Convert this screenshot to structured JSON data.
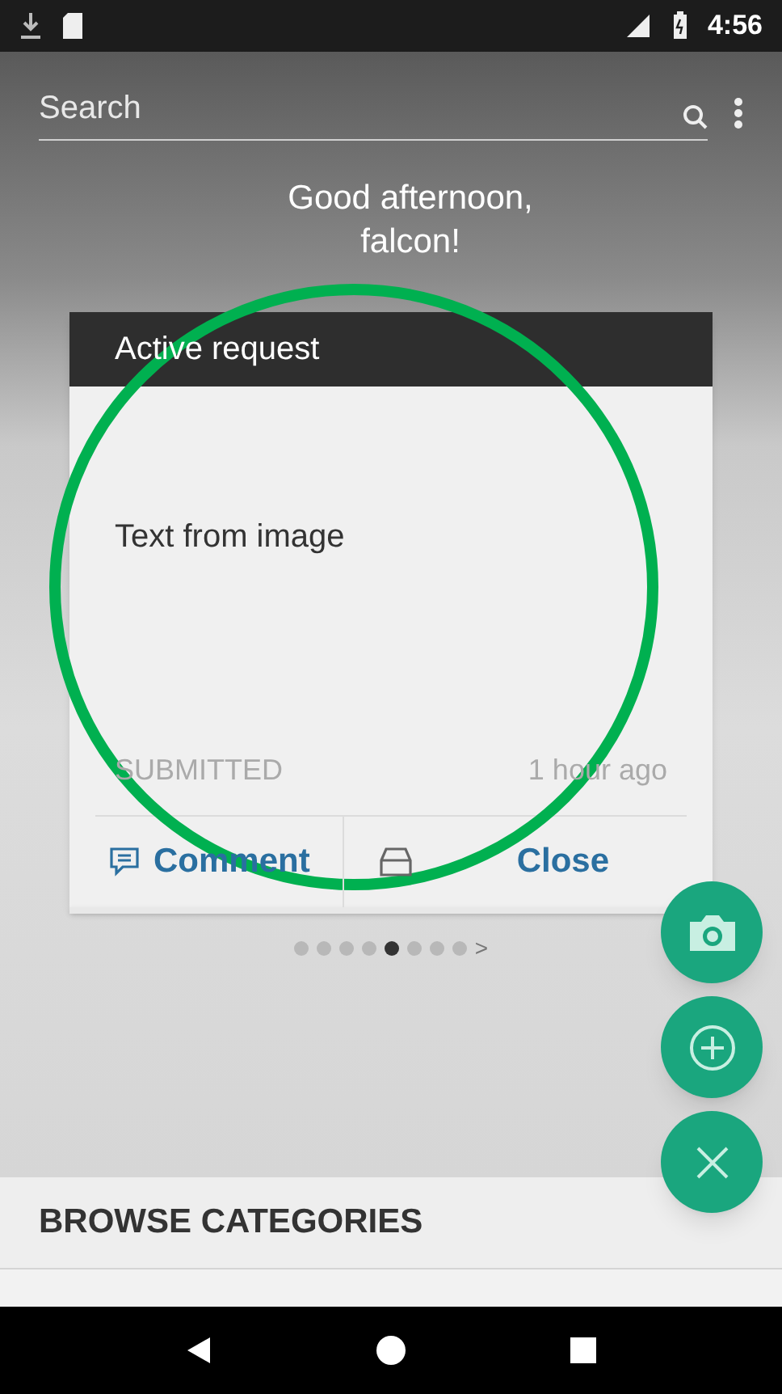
{
  "status_bar": {
    "time": "4:56"
  },
  "search": {
    "placeholder": "Search"
  },
  "greeting": [
    "Good afternoon,",
    "falcon!"
  ],
  "card": {
    "title": "Active request",
    "text": "Text from image",
    "status": "SUBMITTED",
    "time": "1 hour ago",
    "actions": [
      {
        "kind": "comment",
        "label": "Comment"
      },
      {
        "kind": "close",
        "label": "Close"
      }
    ]
  },
  "pager": {
    "dots": [
      {
        "selected": false
      },
      {
        "selected": false
      },
      {
        "selected": false
      },
      {
        "selected": false
      },
      {
        "selected": true
      },
      {
        "selected": false
      },
      {
        "selected": false
      },
      {
        "selected": false
      }
    ],
    "next": ">"
  },
  "fabs": [
    {
      "kind": "camera"
    },
    {
      "kind": "add"
    },
    {
      "kind": "close"
    }
  ],
  "section": {
    "title": "BROWSE CATEGORIES"
  }
}
